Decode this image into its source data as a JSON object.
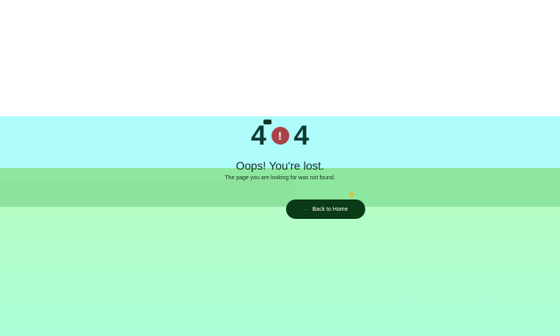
{
  "error": {
    "code_digits": [
      "4",
      "!",
      "4"
    ],
    "headline": "Oops! You're lost.",
    "message": "The page you are looking for was not found."
  },
  "actions": {
    "home_label": "Back to Home",
    "home_icon": "arrow-left-icon"
  },
  "colors": {
    "digit": "#0f3b2f",
    "badge": "#a8434a",
    "button_bg": "#0a3a16",
    "band_cyan": "#aefcfb",
    "band_green": "#8ee79e",
    "band_low": "#b4fdc9"
  }
}
